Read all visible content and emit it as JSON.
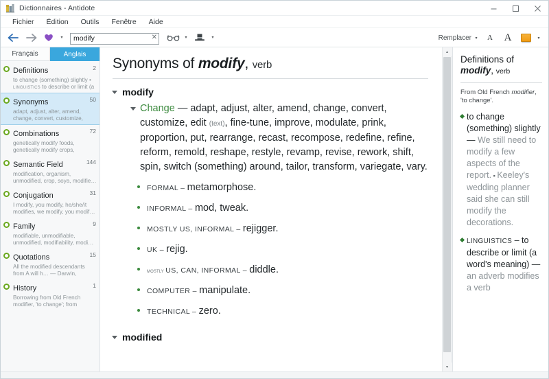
{
  "window": {
    "title": "Dictionnaires - Antidote",
    "icon": "antidote-logo-icon",
    "minimize_label": "–",
    "maximize_label": "□",
    "close_label": "✕"
  },
  "menubar": {
    "items": [
      {
        "label": "Fichier"
      },
      {
        "label": "Édition"
      },
      {
        "label": "Outils"
      },
      {
        "label": "Fenêtre"
      },
      {
        "label": "Aide"
      }
    ]
  },
  "toolbar": {
    "back_icon": "back-arrow-icon",
    "forward_icon": "forward-arrow-icon",
    "favorites_icon": "purple-heart-icon",
    "favorites_caret": "▾",
    "search": {
      "value": "modify",
      "placeholder": "Rechercher",
      "clear_label": "✕"
    },
    "glasses_icon": "glasses-icon",
    "glasses_caret": "▾",
    "hat_icon": "top-hat-icon",
    "hat_caret": "▾",
    "replacer_label": "Remplacer",
    "replacer_caret": "▾",
    "font_small_label": "A",
    "font_large_label": "A",
    "highlight_icon": "highlight-color-icon",
    "highlight_caret": "▾"
  },
  "sidebar": {
    "tabs": [
      {
        "label": "Français",
        "active": false
      },
      {
        "label": "Anglais",
        "active": true
      }
    ],
    "items": [
      {
        "title": "Definitions",
        "count": "2",
        "desc_line1": "to change (something) slightly •",
        "desc_line2_sc": "linguistics",
        "desc_line2": " to describe or limit (a …",
        "selected": false
      },
      {
        "title": "Synonyms",
        "count": "50",
        "desc_line1": "adapt, adjust, alter, amend,",
        "desc_line2_sc": "",
        "desc_line2": "change, convert, customize, edit…",
        "selected": true
      },
      {
        "title": "Combinations",
        "count": "72",
        "desc_line1": "genetically modify foods,",
        "desc_line2_sc": "",
        "desc_line2": "genetically modify crops, geneti…",
        "selected": false
      },
      {
        "title": "Semantic Field",
        "count": "144",
        "desc_line1": "modification, organism,",
        "desc_line2_sc": "",
        "desc_line2": "unmodified, crop, soya, modifie…",
        "selected": false
      },
      {
        "title": "Conjugation",
        "count": "31",
        "desc_line1": "I modify, you modify, he/she/it",
        "desc_line2_sc": "",
        "desc_line2": "modifies, we modify, you modif…",
        "selected": false
      },
      {
        "title": "Family",
        "count": "9",
        "desc_line1": "modifiable, unmodifiable,",
        "desc_line2_sc": "",
        "desc_line2": "unmodified, modifiability, modi…",
        "selected": false
      },
      {
        "title": "Quotations",
        "count": "15",
        "desc_line1": "All the modified descendants",
        "desc_line2_sc": "",
        "desc_line2": "from A will h… — Darwin, Charles",
        "selected": false
      },
      {
        "title": "History",
        "count": "1",
        "desc_line1": "Borrowing from Old French",
        "desc_line2_sc": "",
        "desc_line2": "modifier, 'to change'; from Class…",
        "selected": false
      }
    ]
  },
  "main": {
    "title_prefix": "Synonyms of ",
    "title_word": "modify",
    "title_comma": ", ",
    "title_pos": "verb",
    "entry1_word": "modify",
    "sense": {
      "label": "Change",
      "dash": " — ",
      "text_a": "adapt, adjust, alter, amend, change, convert, customize, edit",
      "gloss": "(text)",
      "text_b": ", fine-tune, improve, modulate, prink, proportion, put, rearrange, recast, recompose, redefine, refine, reform, remold, reshape, restyle, revamp, revise, rework, shift, spin, switch (something) around, tailor, transform, variegate, vary."
    },
    "bullets": [
      {
        "label": "FORMAL",
        "label_lower": "",
        "dash": " – ",
        "words": "metamorphose."
      },
      {
        "label": "INFORMAL",
        "label_lower": "",
        "dash": " – ",
        "words": "mod, tweak."
      },
      {
        "label": "MOSTLY US, INFORMAL",
        "label_lower": "",
        "dash": " – ",
        "words": "rejigger."
      },
      {
        "label": "UK",
        "label_lower": "",
        "dash": " – ",
        "words": "rejig."
      },
      {
        "label": "US, CAN, INFORMAL",
        "label_lower": "mostly ",
        "dash": " – ",
        "words": "diddle."
      },
      {
        "label": "COMPUTER",
        "label_lower": "",
        "dash": " – ",
        "words": "manipulate."
      },
      {
        "label": "TECHNICAL",
        "label_lower": "",
        "dash": " – ",
        "words": "zero."
      }
    ],
    "entry2_word": "modified"
  },
  "right_panel": {
    "title_prefix": "Definitions of ",
    "title_word": "modify",
    "title_comma": ", ",
    "title_pos": "verb",
    "etym_a": "From Old French ",
    "etym_italic": "modifier",
    "etym_b": ", 'to change'.",
    "definitions": [
      {
        "sc_label": "",
        "text": "to change (something) slightly — ",
        "example_a": "We still need to modify a few aspects of the report.",
        "sep": " ▪ ",
        "example_b": "Keeley's wedding planner said she can still modify the decorations."
      },
      {
        "sc_label": "LINGUISTICS",
        "text": " – to describe or limit (a word's meaning) — ",
        "example_a": "an adverb modifies a verb",
        "sep": "",
        "example_b": ""
      }
    ]
  },
  "scrollbars": {
    "main_up_arrow": "▴",
    "main_down_arrow": "▾"
  },
  "colors": {
    "accent_tab": "#3aa7dd",
    "selection": "#d4eaf8",
    "bullet_green": "#6aa81e",
    "sense_green": "#3c8a3e",
    "highlight_orange": "#f2a21a",
    "back_arrow_blue": "#2f6fb5",
    "heart_purple": "#8a4fc4"
  }
}
